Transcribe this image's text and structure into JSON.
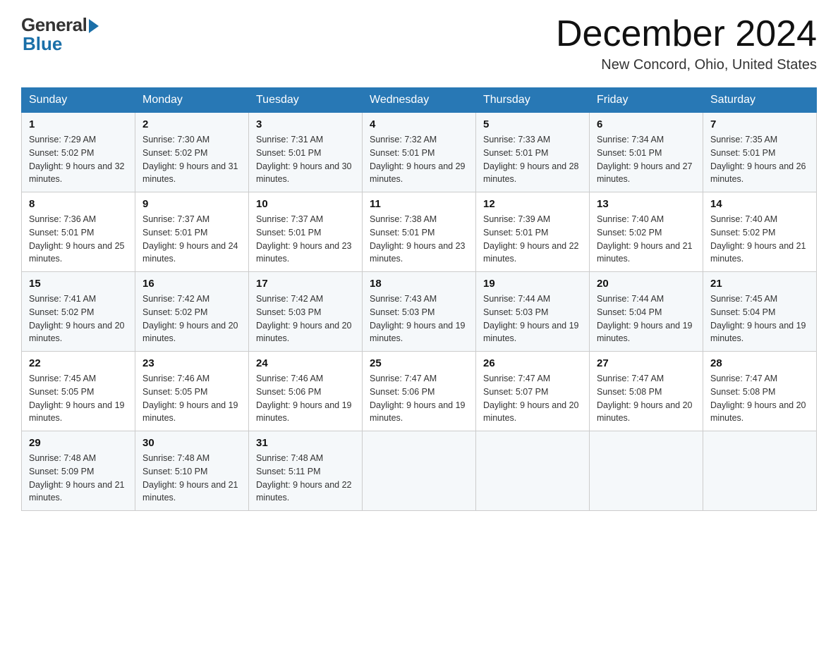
{
  "header": {
    "logo_general": "General",
    "logo_blue": "Blue",
    "title": "December 2024",
    "location": "New Concord, Ohio, United States"
  },
  "calendar": {
    "days_of_week": [
      "Sunday",
      "Monday",
      "Tuesday",
      "Wednesday",
      "Thursday",
      "Friday",
      "Saturday"
    ],
    "weeks": [
      [
        {
          "day": "1",
          "sunrise": "7:29 AM",
          "sunset": "5:02 PM",
          "daylight": "9 hours and 32 minutes."
        },
        {
          "day": "2",
          "sunrise": "7:30 AM",
          "sunset": "5:02 PM",
          "daylight": "9 hours and 31 minutes."
        },
        {
          "day": "3",
          "sunrise": "7:31 AM",
          "sunset": "5:01 PM",
          "daylight": "9 hours and 30 minutes."
        },
        {
          "day": "4",
          "sunrise": "7:32 AM",
          "sunset": "5:01 PM",
          "daylight": "9 hours and 29 minutes."
        },
        {
          "day": "5",
          "sunrise": "7:33 AM",
          "sunset": "5:01 PM",
          "daylight": "9 hours and 28 minutes."
        },
        {
          "day": "6",
          "sunrise": "7:34 AM",
          "sunset": "5:01 PM",
          "daylight": "9 hours and 27 minutes."
        },
        {
          "day": "7",
          "sunrise": "7:35 AM",
          "sunset": "5:01 PM",
          "daylight": "9 hours and 26 minutes."
        }
      ],
      [
        {
          "day": "8",
          "sunrise": "7:36 AM",
          "sunset": "5:01 PM",
          "daylight": "9 hours and 25 minutes."
        },
        {
          "day": "9",
          "sunrise": "7:37 AM",
          "sunset": "5:01 PM",
          "daylight": "9 hours and 24 minutes."
        },
        {
          "day": "10",
          "sunrise": "7:37 AM",
          "sunset": "5:01 PM",
          "daylight": "9 hours and 23 minutes."
        },
        {
          "day": "11",
          "sunrise": "7:38 AM",
          "sunset": "5:01 PM",
          "daylight": "9 hours and 23 minutes."
        },
        {
          "day": "12",
          "sunrise": "7:39 AM",
          "sunset": "5:01 PM",
          "daylight": "9 hours and 22 minutes."
        },
        {
          "day": "13",
          "sunrise": "7:40 AM",
          "sunset": "5:02 PM",
          "daylight": "9 hours and 21 minutes."
        },
        {
          "day": "14",
          "sunrise": "7:40 AM",
          "sunset": "5:02 PM",
          "daylight": "9 hours and 21 minutes."
        }
      ],
      [
        {
          "day": "15",
          "sunrise": "7:41 AM",
          "sunset": "5:02 PM",
          "daylight": "9 hours and 20 minutes."
        },
        {
          "day": "16",
          "sunrise": "7:42 AM",
          "sunset": "5:02 PM",
          "daylight": "9 hours and 20 minutes."
        },
        {
          "day": "17",
          "sunrise": "7:42 AM",
          "sunset": "5:03 PM",
          "daylight": "9 hours and 20 minutes."
        },
        {
          "day": "18",
          "sunrise": "7:43 AM",
          "sunset": "5:03 PM",
          "daylight": "9 hours and 19 minutes."
        },
        {
          "day": "19",
          "sunrise": "7:44 AM",
          "sunset": "5:03 PM",
          "daylight": "9 hours and 19 minutes."
        },
        {
          "day": "20",
          "sunrise": "7:44 AM",
          "sunset": "5:04 PM",
          "daylight": "9 hours and 19 minutes."
        },
        {
          "day": "21",
          "sunrise": "7:45 AM",
          "sunset": "5:04 PM",
          "daylight": "9 hours and 19 minutes."
        }
      ],
      [
        {
          "day": "22",
          "sunrise": "7:45 AM",
          "sunset": "5:05 PM",
          "daylight": "9 hours and 19 minutes."
        },
        {
          "day": "23",
          "sunrise": "7:46 AM",
          "sunset": "5:05 PM",
          "daylight": "9 hours and 19 minutes."
        },
        {
          "day": "24",
          "sunrise": "7:46 AM",
          "sunset": "5:06 PM",
          "daylight": "9 hours and 19 minutes."
        },
        {
          "day": "25",
          "sunrise": "7:47 AM",
          "sunset": "5:06 PM",
          "daylight": "9 hours and 19 minutes."
        },
        {
          "day": "26",
          "sunrise": "7:47 AM",
          "sunset": "5:07 PM",
          "daylight": "9 hours and 20 minutes."
        },
        {
          "day": "27",
          "sunrise": "7:47 AM",
          "sunset": "5:08 PM",
          "daylight": "9 hours and 20 minutes."
        },
        {
          "day": "28",
          "sunrise": "7:47 AM",
          "sunset": "5:08 PM",
          "daylight": "9 hours and 20 minutes."
        }
      ],
      [
        {
          "day": "29",
          "sunrise": "7:48 AM",
          "sunset": "5:09 PM",
          "daylight": "9 hours and 21 minutes."
        },
        {
          "day": "30",
          "sunrise": "7:48 AM",
          "sunset": "5:10 PM",
          "daylight": "9 hours and 21 minutes."
        },
        {
          "day": "31",
          "sunrise": "7:48 AM",
          "sunset": "5:11 PM",
          "daylight": "9 hours and 22 minutes."
        },
        null,
        null,
        null,
        null
      ]
    ]
  }
}
